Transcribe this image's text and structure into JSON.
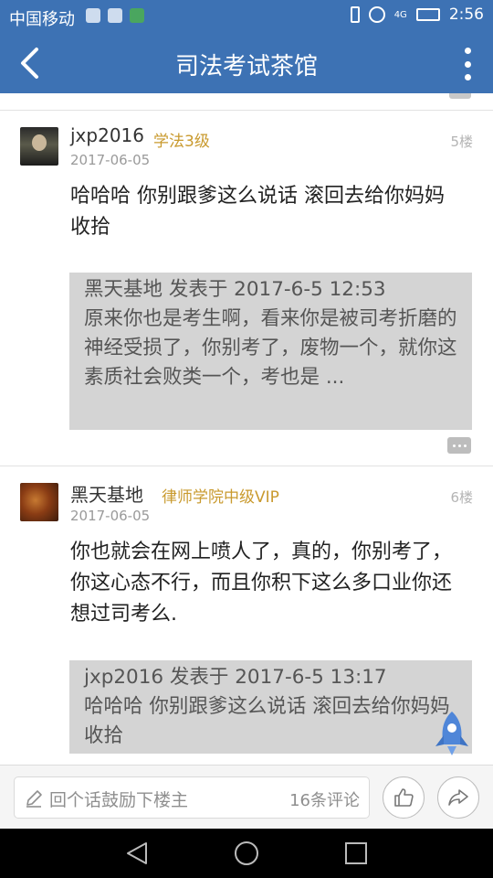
{
  "status_bar": {
    "carrier": "中国移动",
    "network": "4G",
    "time": "2:56"
  },
  "header": {
    "title": "司法考试茶馆"
  },
  "posts": [
    {
      "username": "jxp2016",
      "badge": "学法3级",
      "date": "2017-06-05",
      "floor": "5楼",
      "content": "哈哈哈 你别跟爹这么说话 滚回去给你妈妈收拾",
      "quote": {
        "header": "黑天基地 发表于 2017-6-5 12:53",
        "text": "原来你也是考生啊，看来你是被司考折磨的神经受损了，你别考了，废物一个，就你这素质社会败类一个，考也是 ..."
      }
    },
    {
      "username": "黑天基地",
      "badge": "律师学院中级VIP",
      "date": "2017-06-05",
      "floor": "6楼",
      "content": "你也就会在网上喷人了，真的，你别考了，你这心态不行，而且你积下这么多口业你还想过司考么.",
      "quote": {
        "header": "jxp2016 发表于 2017-6-5 13:17",
        "text": "哈哈哈 你别跟爹这么说话 滚回去给你妈妈收拾"
      }
    }
  ],
  "bottom_bar": {
    "comment_placeholder": "回个话鼓励下楼主",
    "comment_count": "16条评论"
  },
  "icons": {
    "back": "chevron-left-icon",
    "more": "more-vertical-icon",
    "pencil": "pencil-icon",
    "like": "thumbs-up-icon",
    "share": "share-icon",
    "rocket": "rocket-icon"
  },
  "colors": {
    "primary": "#3d72b4",
    "badge": "#c99a2e",
    "quote_bg": "#d4d4d4",
    "rocket": "#4f86d8"
  }
}
